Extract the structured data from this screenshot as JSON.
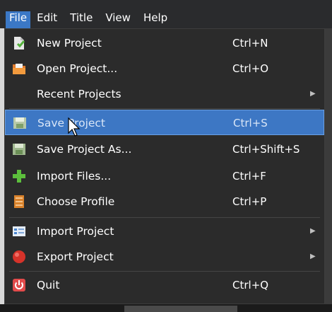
{
  "menubar": {
    "items": [
      "File",
      "Edit",
      "Title",
      "View",
      "Help"
    ],
    "active_index": 0
  },
  "file_menu": {
    "items": [
      {
        "label": "New Project",
        "shortcut": "Ctrl+N",
        "icon": "new-project-icon",
        "submenu": false
      },
      {
        "label": "Open Project...",
        "shortcut": "Ctrl+O",
        "icon": "open-folder-icon",
        "submenu": false
      },
      {
        "label": "Recent Projects",
        "shortcut": "",
        "icon": "",
        "submenu": true
      },
      {
        "label": "Save Project",
        "shortcut": "Ctrl+S",
        "icon": "save-icon",
        "submenu": false,
        "highlighted": true
      },
      {
        "label": "Save Project As...",
        "shortcut": "Ctrl+Shift+S",
        "icon": "save-as-icon",
        "submenu": false
      },
      {
        "label": "Import Files...",
        "shortcut": "Ctrl+F",
        "icon": "plus-icon",
        "submenu": false
      },
      {
        "label": "Choose Profile",
        "shortcut": "Ctrl+P",
        "icon": "profile-icon",
        "submenu": false
      },
      {
        "label": "Import Project",
        "shortcut": "",
        "icon": "import-project-icon",
        "submenu": true
      },
      {
        "label": "Export Project",
        "shortcut": "",
        "icon": "export-project-icon",
        "submenu": true
      },
      {
        "label": "Quit",
        "shortcut": "Ctrl+Q",
        "icon": "power-icon",
        "submenu": false
      }
    ]
  },
  "colors": {
    "menu_bg": "#2b2b2b",
    "highlight": "#3d77c4",
    "active_menubar": "#3b78c6"
  }
}
